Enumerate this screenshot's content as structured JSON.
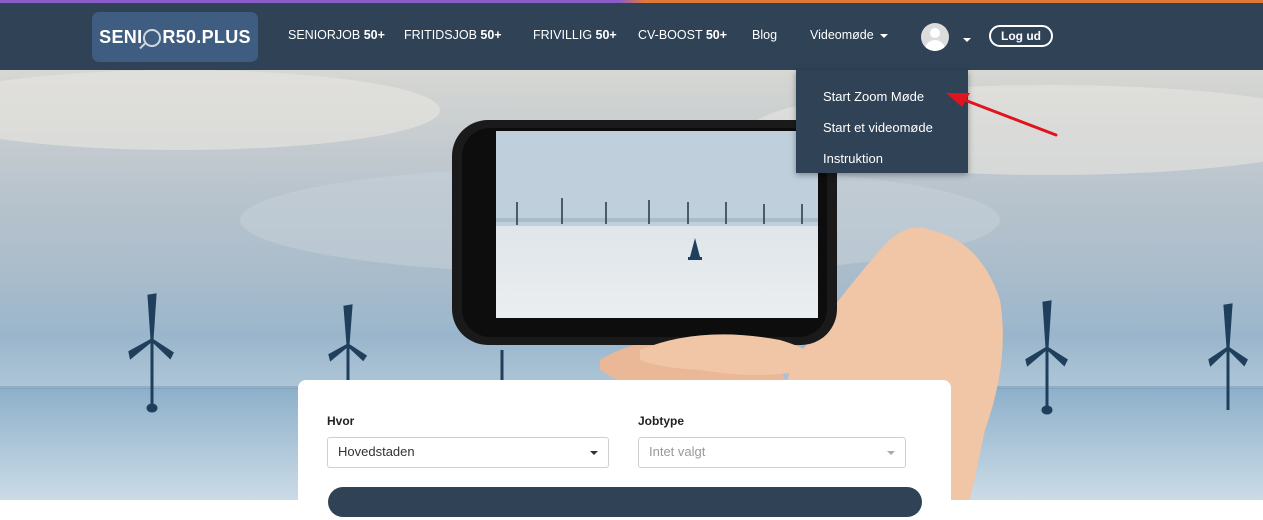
{
  "brand": {
    "logo_before": "SENI",
    "logo_after": "R50.PLUS"
  },
  "nav": {
    "seniorjob_prefix": "SENIORJOB",
    "seniorjob_suffix": "50+",
    "fritidsjob_prefix": "FRITIDSJOB",
    "fritidsjob_suffix": "50+",
    "frivillig_prefix": "FRIVILLIG",
    "frivillig_suffix": "50+",
    "cvboost_prefix": "CV-BOOST",
    "cvboost_suffix": "50+",
    "blog": "Blog",
    "videomode": "Videomøde",
    "logout": "Log ud"
  },
  "dropdown": {
    "items": [
      "Start Zoom Møde",
      "Start et videomøde",
      "Instruktion"
    ]
  },
  "search": {
    "where_label": "Hvor",
    "where_value": "Hovedstaden",
    "jobtype_label": "Jobtype",
    "jobtype_placeholder": "Intet valgt"
  },
  "colors": {
    "navbar": "#2f4256",
    "logo_bg": "#3f5d80",
    "annotation_arrow": "#e0141e"
  }
}
